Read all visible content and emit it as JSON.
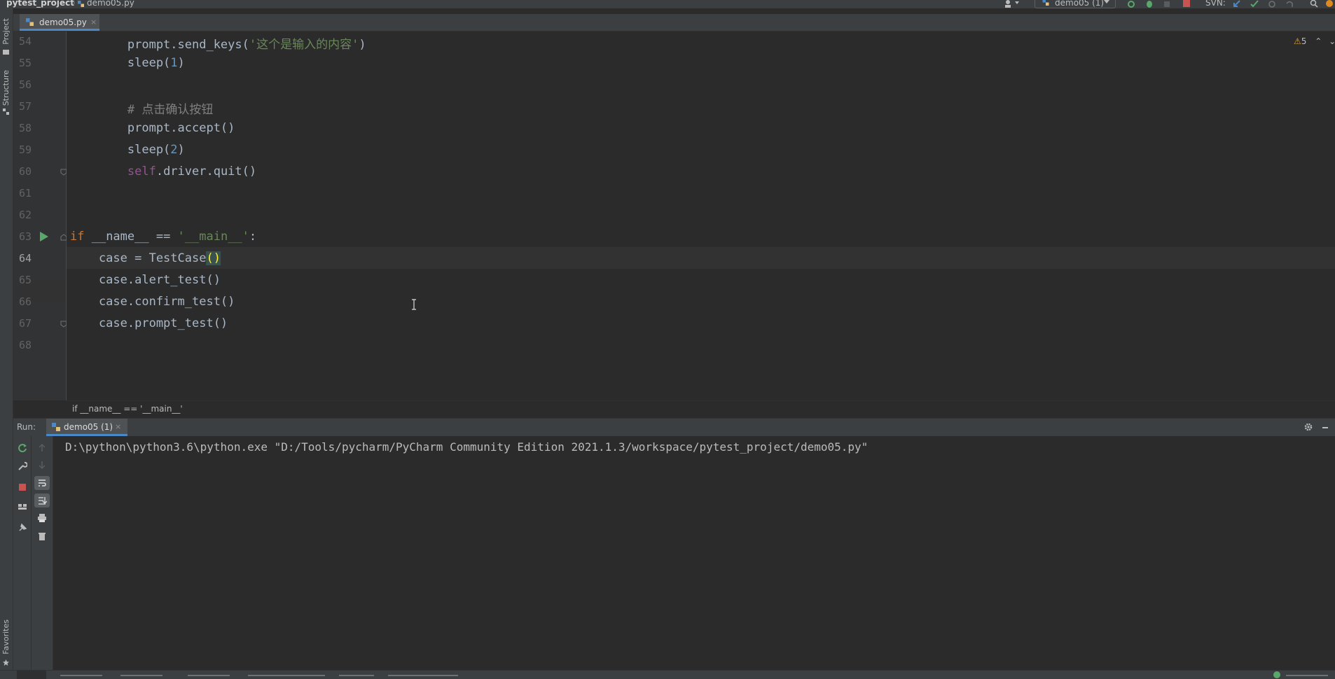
{
  "navbar": {
    "project": "pytest_project",
    "file": "demo05.py",
    "run_config": "demo05 (1)",
    "svn_label": "SVN:"
  },
  "left_stripe": {
    "project_label": "Project",
    "structure_label": "Structure",
    "favorites_label": "Favorites"
  },
  "editor": {
    "tab_label": "demo05.py",
    "tab_close": "×",
    "warnings": "5",
    "breadcrumb": "if __name__ == '__main__'",
    "line_numbers": [
      "54",
      "55",
      "56",
      "57",
      "58",
      "59",
      "60",
      "61",
      "62",
      "63",
      "64",
      "65",
      "66",
      "67",
      "68"
    ],
    "lines": {
      "l54a": "        prompt.send_keys(",
      "l54b": "'这个是输入的内容'",
      "l54c": ")",
      "l55a": "        sleep(",
      "l55b": "1",
      "l55c": ")",
      "l57": "        # 点击确认按钮",
      "l58": "        prompt.accept()",
      "l59a": "        sleep(",
      "l59b": "2",
      "l59c": ")",
      "l60a": "        self",
      "l60b": ".driver.quit()",
      "l63a": "if",
      "l63b": " __name__ == ",
      "l63c": "'__main__'",
      "l63d": ":",
      "l64a": "    case = TestCase",
      "l64b": "()",
      "l65": "    case.alert_test()",
      "l66": "    case.confirm_test()",
      "l67": "    case.prompt_test()"
    }
  },
  "run_panel": {
    "label": "Run:",
    "tab_label": "demo05 (1)",
    "tab_close": "×",
    "console_output": "D:\\python\\python3.6\\python.exe \"D:/Tools/pycharm/PyCharm Community Edition 2021.1.3/workspace/pytest_project/demo05.py\""
  },
  "colors": {
    "editor_bg": "#2b2b2b",
    "panel_bg": "#3c3f41",
    "keyword": "#cc7832",
    "string": "#6a8759",
    "number": "#6897bb",
    "comment": "#808080",
    "self": "#94558d",
    "run_green": "#59a869",
    "stop_red": "#c75450",
    "accent_blue": "#4a88c7"
  }
}
